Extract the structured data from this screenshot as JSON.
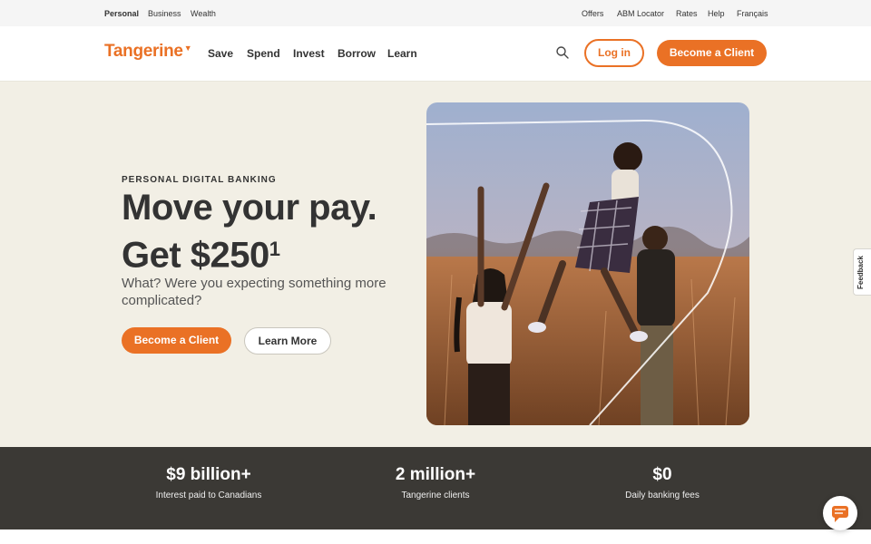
{
  "utility_bar": {
    "left": [
      "Personal",
      "Business",
      "Wealth"
    ],
    "right": [
      "Offers",
      "ABM Locator",
      "Rates",
      "Help",
      "Français"
    ]
  },
  "header": {
    "logo": "Tangerine",
    "nav": [
      "Save",
      "Spend",
      "Invest",
      "Borrow",
      "Learn"
    ],
    "login_label": "Log in",
    "become_label": "Become a Client"
  },
  "hero": {
    "eyebrow": "PERSONAL DIGITAL BANKING",
    "headline_line1": "Move your pay.",
    "headline_line2": "Get $250",
    "footnote": "1",
    "subhead": "What? Were you expecting something more complicated?",
    "primary_cta": "Become a Client",
    "secondary_cta": "Learn More"
  },
  "stats": [
    {
      "value": "$9 billion+",
      "label": "Interest paid to Canadians"
    },
    {
      "value": "2 million+",
      "label": "Tangerine clients"
    },
    {
      "value": "$0",
      "label": "Daily banking fees"
    }
  ],
  "feedback_label": "Feedback",
  "colors": {
    "brand_orange": "#ea7125",
    "hero_bg": "#f2efe5",
    "stats_bg": "#3b3935"
  },
  "icons": {
    "search": "search-icon",
    "chat": "chat-icon"
  }
}
